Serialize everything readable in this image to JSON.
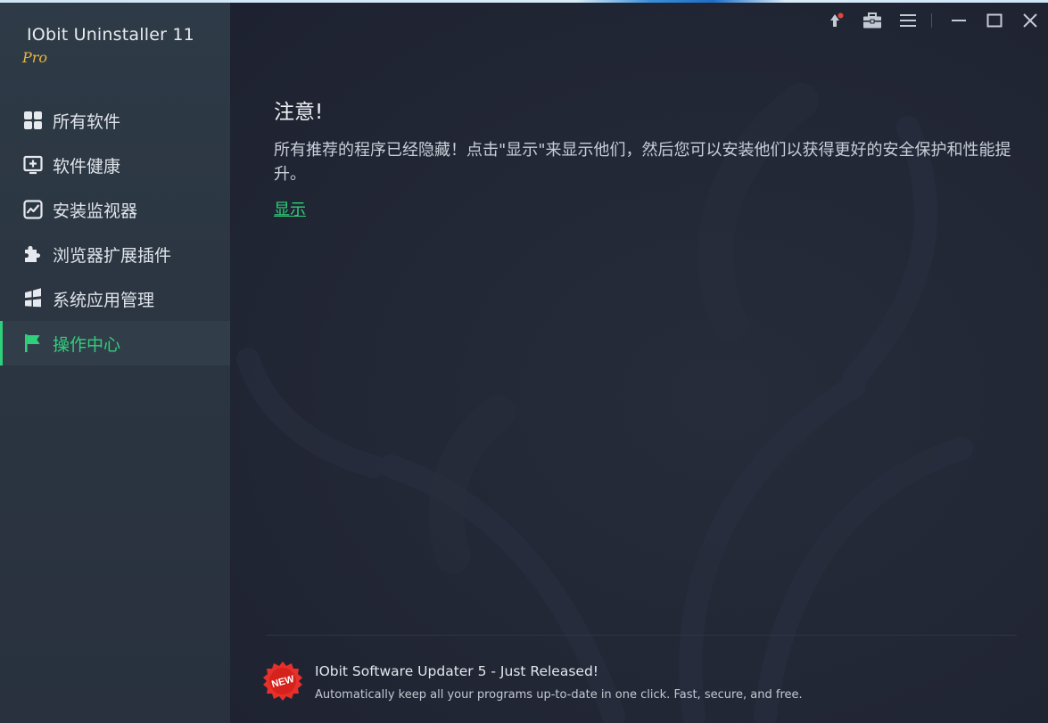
{
  "app": {
    "title": "IObit Uninstaller 11",
    "edition": "Pro"
  },
  "sidebar": {
    "items": [
      {
        "label": "所有软件",
        "icon": "grid-icon",
        "active": false
      },
      {
        "label": "软件健康",
        "icon": "monitor-plus-icon",
        "active": false
      },
      {
        "label": "安装监视器",
        "icon": "chart-line-icon",
        "active": false
      },
      {
        "label": "浏览器扩展插件",
        "icon": "puzzle-icon",
        "active": false
      },
      {
        "label": "系统应用管理",
        "icon": "windows-icon",
        "active": false
      },
      {
        "label": "操作中心",
        "icon": "flag-icon",
        "active": true
      }
    ]
  },
  "titlebar": {
    "buttons": [
      "notification-icon",
      "toolbox-icon",
      "menu-icon",
      "minimize-icon",
      "maximize-icon",
      "close-icon"
    ]
  },
  "notice": {
    "title": "注意!",
    "text": "所有推荐的程序已经隐藏！点击\"显示\"来显示他们，然后您可以安装他们以获得更好的安全保护和性能提升。",
    "link": "显示"
  },
  "promo": {
    "badge": "NEW",
    "title": "IObit Software Updater 5 - Just Released!",
    "description": "Automatically keep all your programs up-to-date in one click. Fast, secure, and free."
  },
  "colors": {
    "accent": "#2fd07a",
    "edition": "#e7b73b",
    "sidebar_bg": "#2b3541",
    "main_bg": "#222735"
  }
}
